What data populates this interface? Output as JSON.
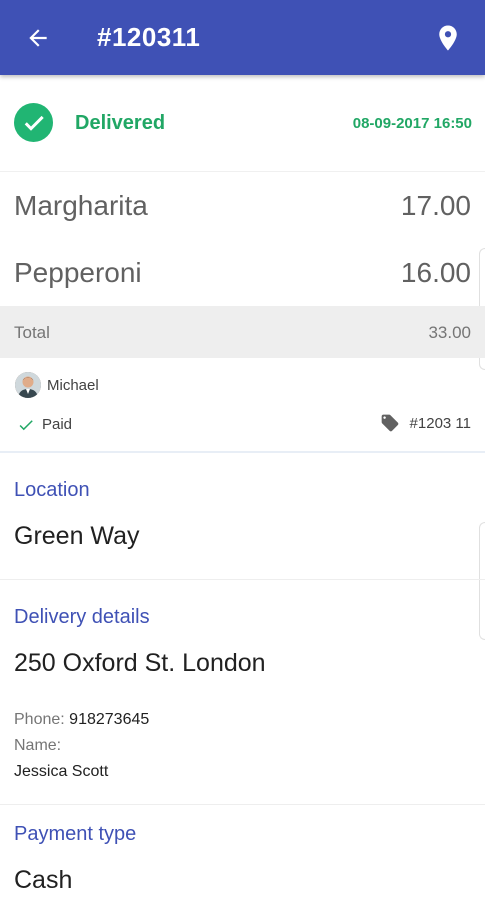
{
  "app_bar": {
    "title": "#120311",
    "back_icon": "arrow-back-icon",
    "location_icon": "map-pin-icon",
    "color": "#3f51b5"
  },
  "status": {
    "label": "Delivered",
    "datetime": "08-09-2017 16:50",
    "icon": "check-circle-icon",
    "color": "#21a765"
  },
  "items": [
    {
      "name": "Margharita",
      "price": "17.00"
    },
    {
      "name": "Pepperoni",
      "price": "16.00"
    }
  ],
  "total": {
    "label": "Total",
    "value": "33.00"
  },
  "meta": {
    "user": "Michael",
    "payment_status": "Paid",
    "tag": "#1203 11"
  },
  "location": {
    "label": "Location",
    "value": "Green Way"
  },
  "delivery": {
    "label": "Delivery details",
    "address": "250 Oxford St. London",
    "phone_label": "Phone:",
    "phone": "918273645",
    "name_label": "Name:",
    "name": "Jessica Scott"
  },
  "payment": {
    "label": "Payment type",
    "value": "Cash"
  }
}
